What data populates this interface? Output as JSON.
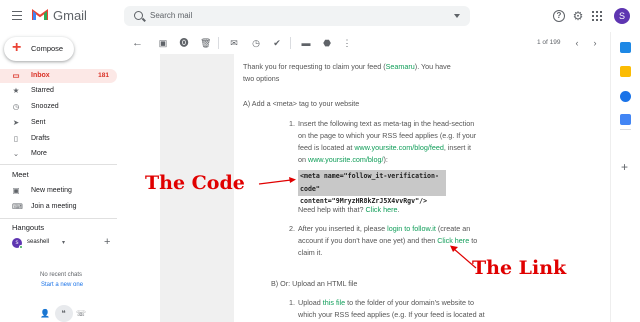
{
  "app": {
    "name": "Gmail"
  },
  "search": {
    "placeholder": "Search mail"
  },
  "header": {
    "avatar_letter": "S",
    "help_symbol": "?"
  },
  "compose": {
    "label": "Compose"
  },
  "nav": [
    {
      "label": "Inbox",
      "count": "181",
      "icon": "inbox-icon"
    },
    {
      "label": "Starred",
      "icon": "star-icon"
    },
    {
      "label": "Snoozed",
      "icon": "clock-icon"
    },
    {
      "label": "Sent",
      "icon": "send-icon"
    },
    {
      "label": "Drafts",
      "icon": "draft-icon"
    },
    {
      "label": "More",
      "icon": "chevron-down-icon"
    }
  ],
  "meet": {
    "heading": "Meet",
    "new_meeting": "New meeting",
    "join": "Join a meeting"
  },
  "hangouts": {
    "heading": "Hangouts",
    "user": "seashell",
    "avatar_letter": "s",
    "no_chats": "No recent chats",
    "start": "Start a new one"
  },
  "toolbar": {
    "pager": "1 of 199"
  },
  "email": {
    "intro_1": "Thank you for requesting to claim your feed (",
    "feed_name": "Seamaru",
    "intro_2": "). You have",
    "intro_3": "two options",
    "option_a": "A) Add a <meta> tag to your website",
    "step1_l1": "Insert the following text as meta-tag in the head-section",
    "step1_l2": "on the page to which your RSS feed applies (e.g. If your",
    "step1_l3a": "feed is located at ",
    "step1_url1": "www.yoursite.com/blog/feed",
    "step1_l3b": ", insert it",
    "step1_l4a": "on ",
    "step1_url2": "www.yoursite.com/blog/",
    "step1_l4b": "):",
    "code_line1": "<meta name=\"follow_it-verification-code\"",
    "code_line2": "content=\"9MryzHR8kZrJ5X4vvRgv\"/>",
    "help_a": "Need help with that? ",
    "click_here_1": "Click here",
    "help_b": ".",
    "step2_l1a": "After you inserted it, please ",
    "step2_login": "login to follow.it",
    "step2_l1b": " (create an",
    "step2_l2a": "account if you don't have one yet) and then ",
    "click_here_2": "Click here",
    "step2_l2b": " to",
    "step2_l3": "claim it.",
    "option_b": "B) Or: Upload an HTML file",
    "step3_l1a": "Upload ",
    "step3_file": "this file",
    "step3_l1b": " to the folder of your domain's website to",
    "step3_l2": "which your RSS feed applies (e.g. If your feed is located at"
  },
  "annotations": {
    "code": "The Code",
    "link": "The Link"
  },
  "colors": {
    "annotation": "#e00000",
    "inbox_bg": "#fce8e6",
    "inbox_text": "#d93025",
    "link_green": "#0f9d58",
    "code_bg": "#c8c8c8"
  }
}
